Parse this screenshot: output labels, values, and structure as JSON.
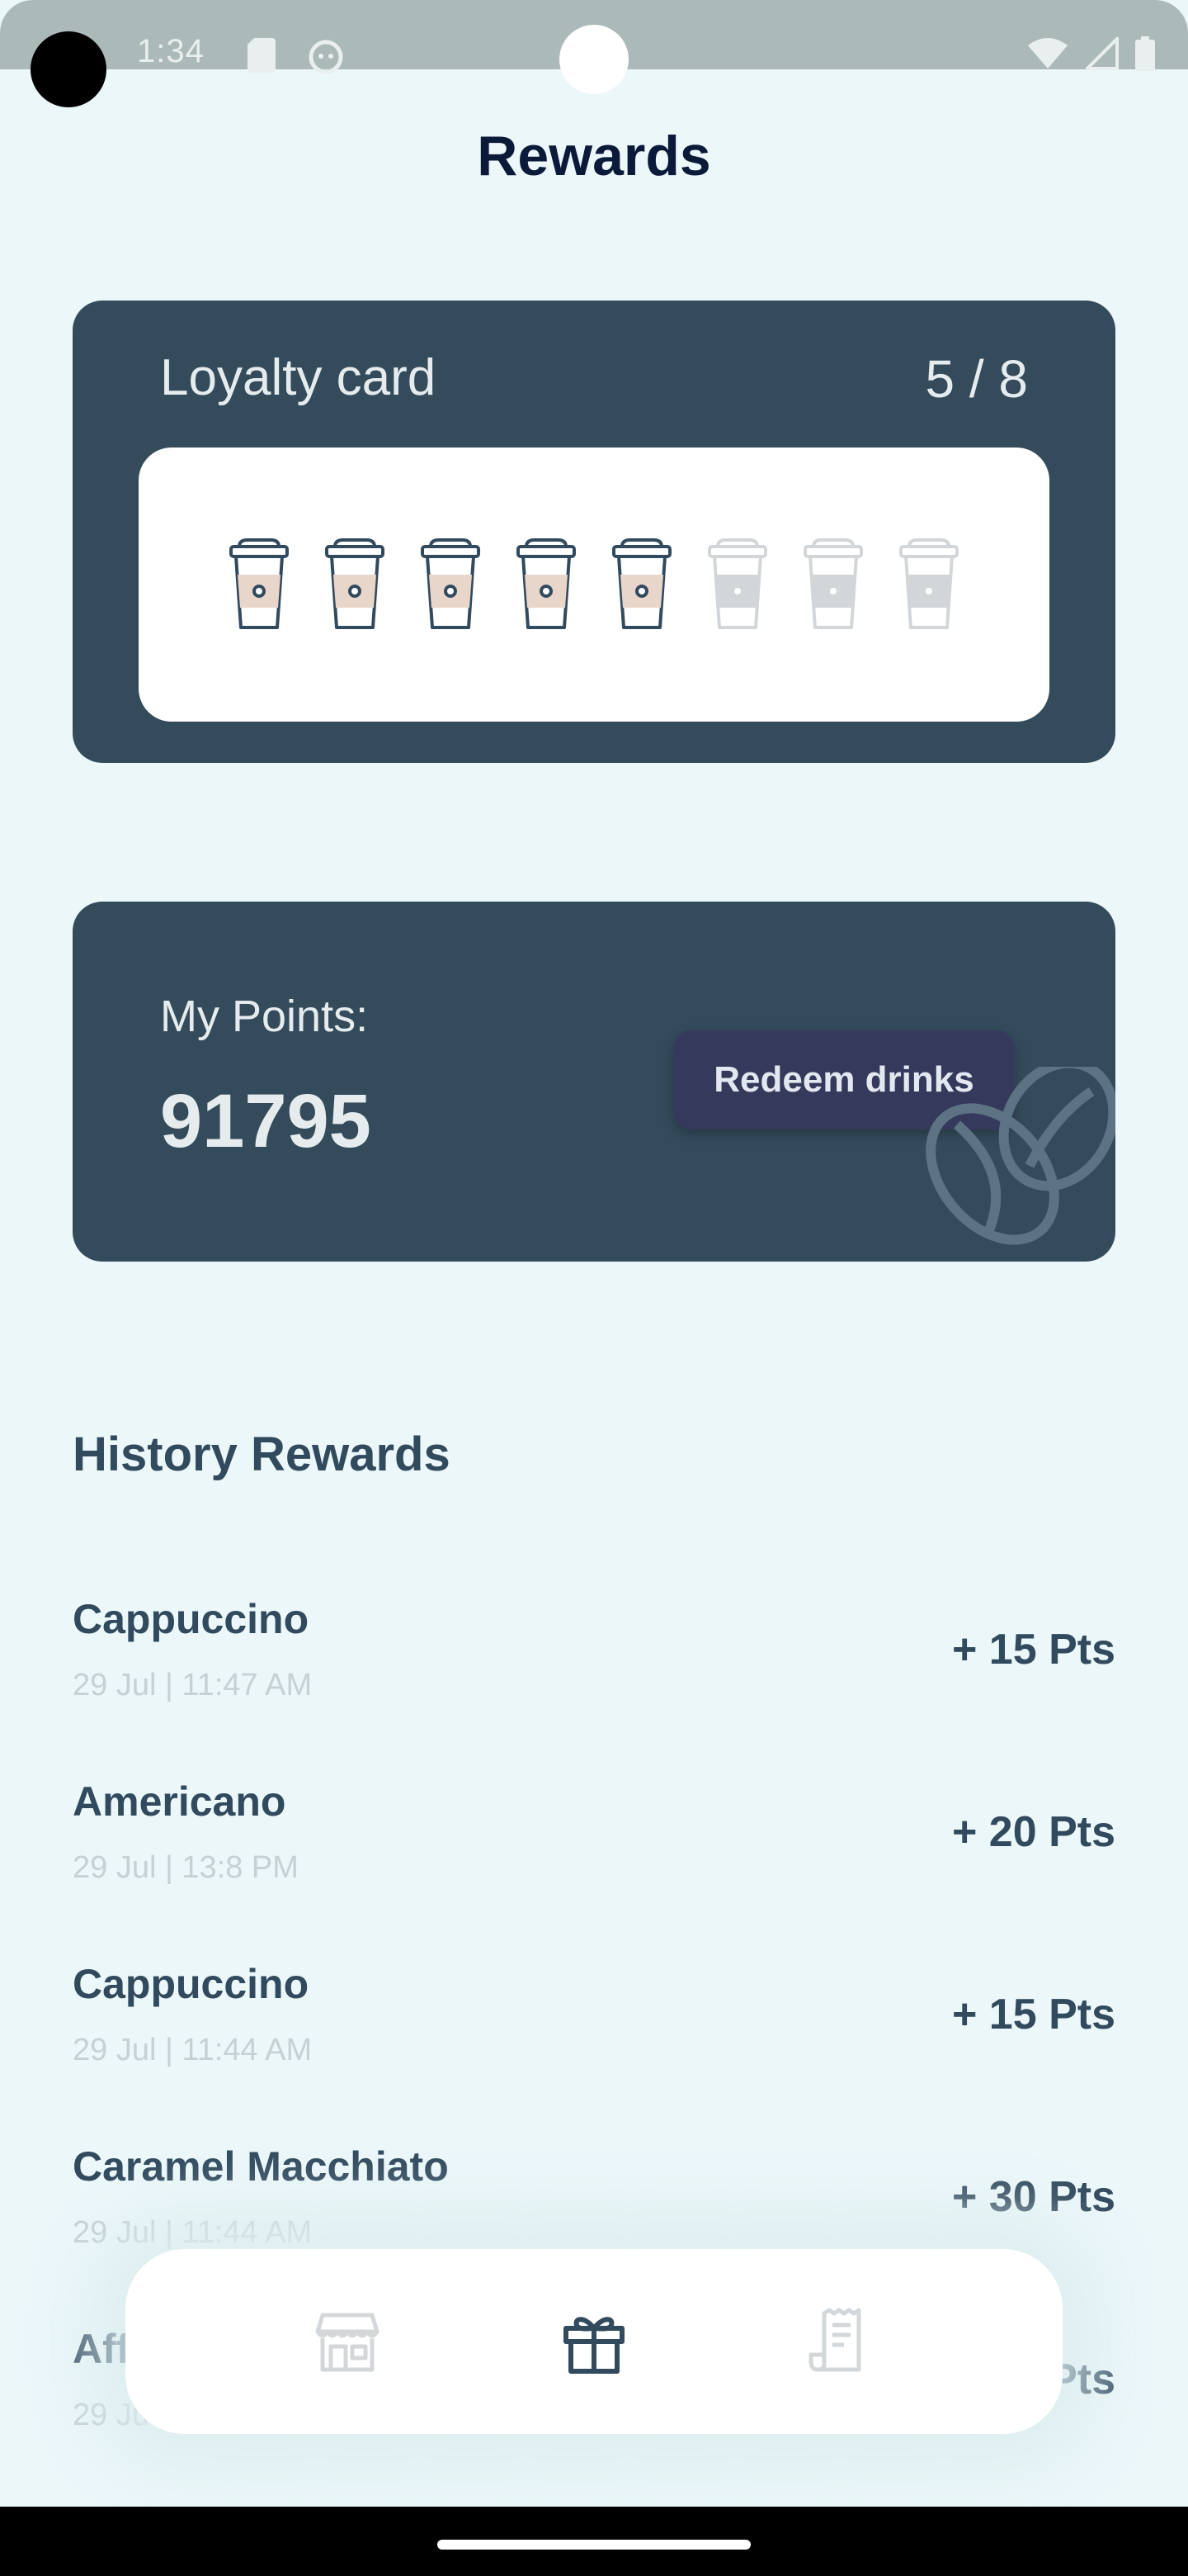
{
  "status_bar": {
    "time": "1:34"
  },
  "page": {
    "title": "Rewards"
  },
  "loyalty": {
    "title": "Loyalty card",
    "count": "5 / 8",
    "filled": 5,
    "total": 8,
    "fill_color": "#e9d6ca",
    "stroke_color": "#324a5e",
    "empty_color": "#d2d6d8"
  },
  "points": {
    "label": "My Points:",
    "value": "91795",
    "redeem_label": "Redeem drinks"
  },
  "history": {
    "title": "History Rewards",
    "items": [
      {
        "name": "Cappuccino",
        "date": "29 Jul | 11:47 AM",
        "points": "+ 15 Pts"
      },
      {
        "name": "Americano",
        "date": "29 Jul | 13:8 PM",
        "points": "+ 20 Pts"
      },
      {
        "name": "Cappuccino",
        "date": "29 Jul | 11:44 AM",
        "points": "+ 15 Pts"
      },
      {
        "name": "Caramel Macchiato",
        "date": "29 Jul | 11:44 AM",
        "points": "+ 30 Pts"
      },
      {
        "name": "Aff",
        "date": "29 Ju",
        "points": "Pts"
      }
    ]
  },
  "nav": {
    "items": [
      "store-icon",
      "gift-icon",
      "receipt-icon"
    ],
    "active": "gift-icon"
  }
}
